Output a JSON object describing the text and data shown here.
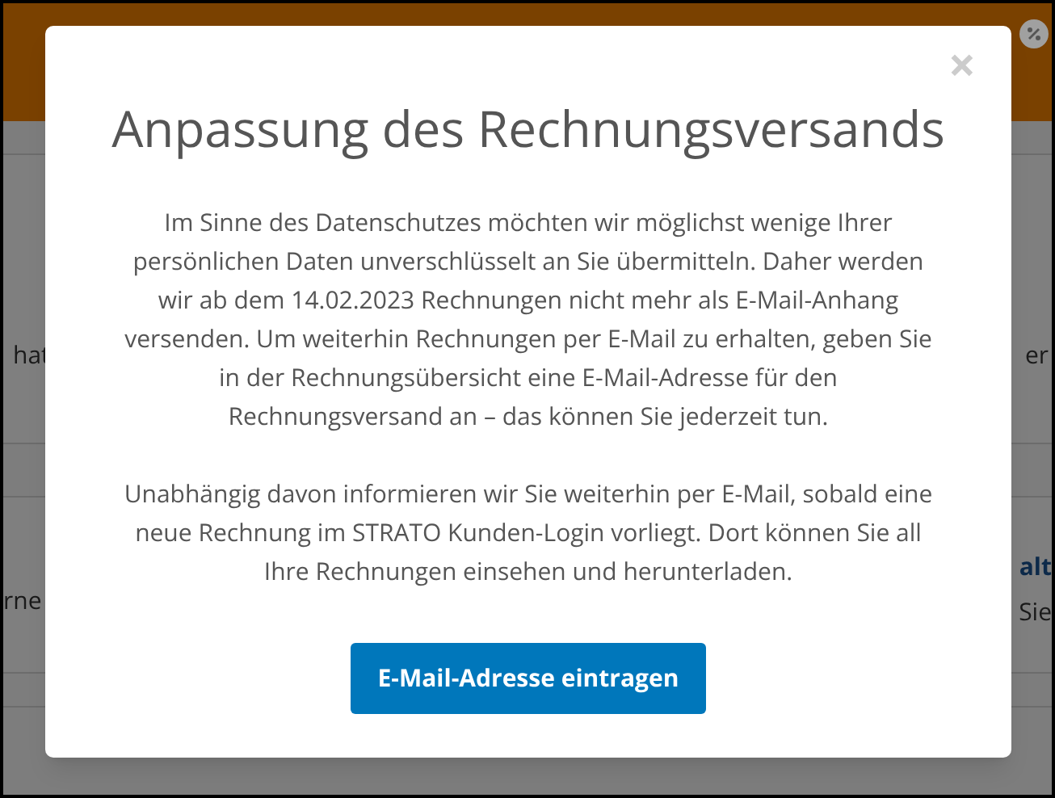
{
  "background": {
    "left_fragments": [
      "hat",
      "rne"
    ],
    "right_fragments": [
      "er",
      "alt",
      "Sie"
    ]
  },
  "dialog": {
    "close": "×",
    "title": "Anpassung des Rechnungsversands",
    "paragraphs": [
      "Im Sinne des Datenschutzes möchten wir möglichst wenige Ihrer persönlichen Daten unverschlüsselt an Sie übermitteln. Daher werden wir ab dem 14.02.2023 Rechnungen nicht mehr als E-Mail-Anhang versenden. Um weiterhin Rechnungen per E-Mail zu erhalten, geben Sie in der Rechnungsübersicht eine E-Mail-Adresse für den Rechnungsversand an – das können Sie jederzeit tun.",
      "Unabhängig davon informieren wir Sie weiterhin per E-Mail, sobald eine neue Rechnung im STRATO Kunden-Login vorliegt. Dort können Sie all Ihre Rechnungen einsehen und herunterladen."
    ],
    "button": "E-Mail-Adresse eintragen"
  }
}
